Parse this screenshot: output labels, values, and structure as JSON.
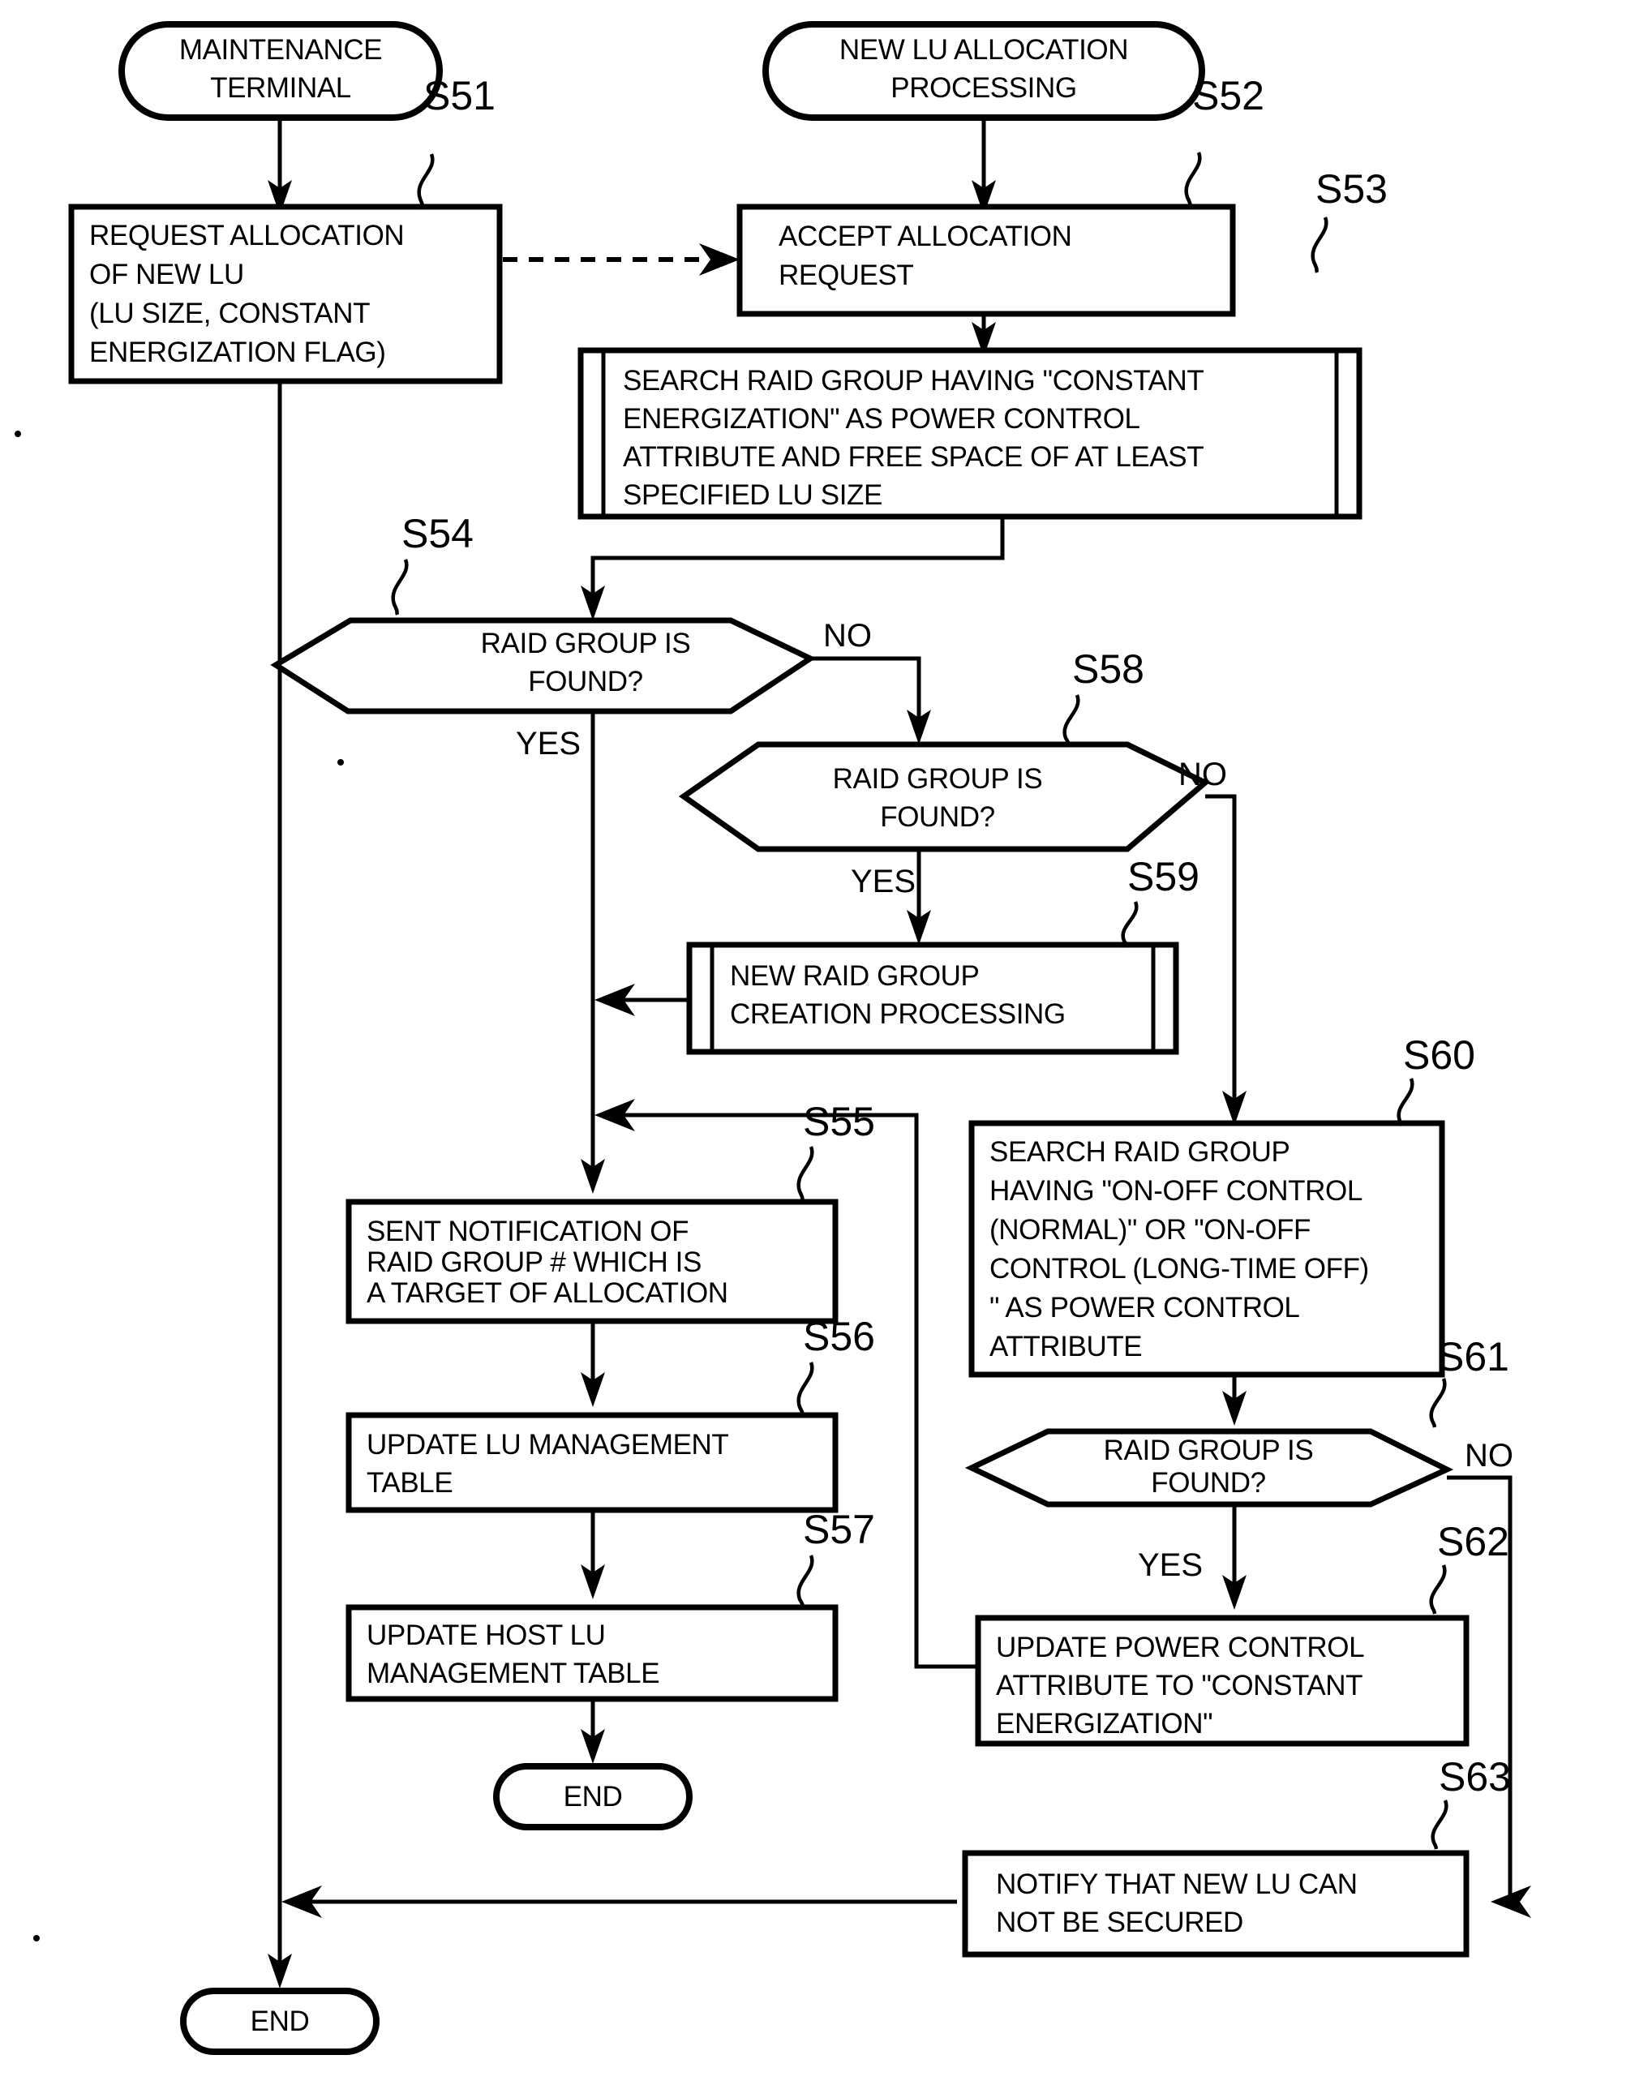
{
  "diagram": {
    "type": "flowchart",
    "title": "NEW LU ALLOCATION PROCESSING FLOWCHART",
    "lanes": [
      {
        "id": "maintenance-terminal",
        "label": "MAINTENANCE TERMINAL"
      },
      {
        "id": "storage-controller",
        "label": "NEW LU ALLOCATION PROCESSING"
      }
    ],
    "terminators": {
      "start_left_line1": "MAINTENANCE",
      "start_left_line2": "TERMINAL",
      "start_right_line1": "NEW LU ALLOCATION",
      "start_right_line2": "PROCESSING",
      "end_middle": "END",
      "end_left": "END"
    },
    "nodes": [
      {
        "id": "S51",
        "step": "S51",
        "shape": "process",
        "lines": [
          "REQUEST ALLOCATION",
          "OF NEW LU",
          " (LU SIZE, CONSTANT",
          "ENERGIZATION FLAG)"
        ]
      },
      {
        "id": "S52",
        "step": "S52",
        "shape": "process",
        "lines": [
          "ACCEPT ALLOCATION",
          "REQUEST"
        ]
      },
      {
        "id": "S53",
        "step": "S53",
        "shape": "predefined-process",
        "lines": [
          "SEARCH RAID GROUP HAVING \"CONSTANT",
          "ENERGIZATION\" AS POWER CONTROL",
          "ATTRIBUTE AND FREE SPACE OF AT LEAST",
          "SPECIFIED LU SIZE"
        ]
      },
      {
        "id": "S54",
        "step": "S54",
        "shape": "decision",
        "lines": [
          "RAID GROUP IS",
          "FOUND?"
        ],
        "branches": {
          "yes": "YES",
          "no": "NO"
        }
      },
      {
        "id": "S58",
        "step": "S58",
        "shape": "decision",
        "lines": [
          "RAID GROUP IS",
          "FOUND?"
        ],
        "branches": {
          "yes": "YES",
          "no": "NO"
        }
      },
      {
        "id": "S59",
        "step": "S59",
        "shape": "predefined-process",
        "lines": [
          "NEW RAID GROUP",
          "CREATION PROCESSING"
        ]
      },
      {
        "id": "S60",
        "step": "S60",
        "shape": "process",
        "lines": [
          "SEARCH RAID GROUP",
          "HAVING \"ON-OFF CONTROL",
          " (NORMAL)\" OR \"ON-OFF",
          "CONTROL (LONG-TIME OFF)",
          "\" AS POWER CONTROL",
          "ATTRIBUTE"
        ]
      },
      {
        "id": "S55",
        "step": "S55",
        "shape": "process",
        "lines": [
          "SENT NOTIFICATION OF",
          "RAID GROUP # WHICH IS",
          "A TARGET OF ALLOCATION"
        ]
      },
      {
        "id": "S56",
        "step": "S56",
        "shape": "process",
        "lines": [
          "UPDATE LU MANAGEMENT",
          "TABLE"
        ]
      },
      {
        "id": "S57",
        "step": "S57",
        "shape": "process",
        "lines": [
          "UPDATE HOST LU",
          "MANAGEMENT TABLE"
        ]
      },
      {
        "id": "S61",
        "step": "S61",
        "shape": "decision",
        "lines": [
          "RAID GROUP IS",
          "FOUND?"
        ],
        "branches": {
          "yes": "YES",
          "no": "NO"
        }
      },
      {
        "id": "S62",
        "step": "S62",
        "shape": "process",
        "lines": [
          "UPDATE POWER CONTROL",
          "ATTRIBUTE TO \"CONSTANT",
          "ENERGIZATION\""
        ]
      },
      {
        "id": "S63",
        "step": "S63",
        "shape": "process",
        "lines": [
          "NOTIFY THAT NEW LU CAN",
          "NOT BE SECURED"
        ]
      }
    ],
    "edge_labels": {
      "s54_no": "NO",
      "s54_yes": "YES",
      "s58_no": "NO",
      "s58_yes": "YES",
      "s61_no": "NO",
      "s61_yes": "YES"
    },
    "step_labels": {
      "S51": "S51",
      "S52": "S52",
      "S53": "S53",
      "S54": "S54",
      "S55": "S55",
      "S56": "S56",
      "S57": "S57",
      "S58": "S58",
      "S59": "S59",
      "S60": "S60",
      "S61": "S61",
      "S62": "S62",
      "S63": "S63"
    },
    "colors": {
      "stroke": "#000000",
      "fill": "#ffffff",
      "background": "#ffffff"
    }
  }
}
